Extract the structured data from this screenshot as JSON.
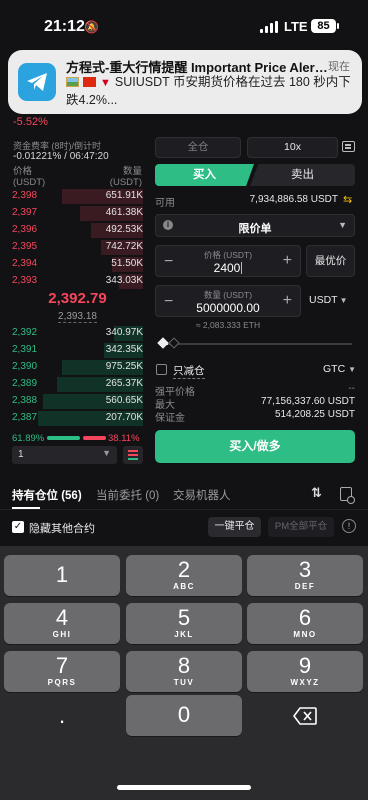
{
  "status_bar": {
    "time": "21:12",
    "network": "LTE",
    "battery": "85"
  },
  "notification": {
    "title": "方程式-重大行情提醒 Important Price Aler…",
    "time": "现在",
    "body": "SUIUSDT 币安期货价格在过去 180 秒内下跌4.2%..."
  },
  "ticker": {
    "change_pct": "-5.52%"
  },
  "funding": {
    "label": "资金费率 (8时)/倒计时",
    "value": "-0.01221% / 06:47:20"
  },
  "orderbook": {
    "col_price": "价格",
    "col_price_unit": "(USDT)",
    "col_qty": "数量",
    "col_qty_unit": "(USDT)",
    "asks": [
      {
        "price": "2,398",
        "qty": "651.91K",
        "depth": 0.62
      },
      {
        "price": "2,397",
        "qty": "461.38K",
        "depth": 0.48
      },
      {
        "price": "2,396",
        "qty": "492.53K",
        "depth": 0.4
      },
      {
        "price": "2,395",
        "qty": "742.72K",
        "depth": 0.32
      },
      {
        "price": "2,394",
        "qty": "51.50K",
        "depth": 0.24
      },
      {
        "price": "2,393",
        "qty": "343.03K",
        "depth": 0.18
      }
    ],
    "last_price": "2,392.79",
    "mark_price": "2,393.18",
    "bids": [
      {
        "price": "2,392",
        "qty": "340.97K",
        "depth": 0.22
      },
      {
        "price": "2,391",
        "qty": "342.35K",
        "depth": 0.3
      },
      {
        "price": "2,390",
        "qty": "975.25K",
        "depth": 0.62
      },
      {
        "price": "2,389",
        "qty": "265.37K",
        "depth": 0.66
      },
      {
        "price": "2,388",
        "qty": "560.65K",
        "depth": 0.76
      },
      {
        "price": "2,387",
        "qty": "207.70K",
        "depth": 0.8
      }
    ],
    "buy_ratio": "61.89%",
    "sell_ratio": "38.11%",
    "depth_value": "1"
  },
  "order_form": {
    "margin_mode": "全仓",
    "leverage": "10x",
    "buy_tab": "买入",
    "sell_tab": "卖出",
    "available_label": "可用",
    "available_value": "7,934,886.58 USDT",
    "order_type": "限价单",
    "price_caption": "价格 (USDT)",
    "price_value": "2400",
    "bbo_label": "最优价",
    "qty_caption": "数量 (USDT)",
    "qty_value": "5000000.00",
    "qty_unit": "USDT",
    "qty_equiv": "≈ 2,083.333 ETH",
    "reduce_only": "只减仓",
    "tif": "GTC",
    "liq_label": "强平价格",
    "liq_value": "--",
    "max_label": "最大",
    "max_value": "77,156,337.60 USDT",
    "margin_label": "保证金",
    "margin_value": "514,208.25 USDT",
    "submit_label": "买入/做多"
  },
  "positions": {
    "tabs": [
      "持有仓位 (56)",
      "当前委托 (0)",
      "交易机器人"
    ],
    "hide_other": "隐藏其他合约",
    "close_all": "一键平仓",
    "pm_close": "PM全部平仓"
  },
  "keyboard": {
    "keys": [
      {
        "digit": "1",
        "letters": ""
      },
      {
        "digit": "2",
        "letters": "ABC"
      },
      {
        "digit": "3",
        "letters": "DEF"
      },
      {
        "digit": "4",
        "letters": "GHI"
      },
      {
        "digit": "5",
        "letters": "JKL"
      },
      {
        "digit": "6",
        "letters": "MNO"
      },
      {
        "digit": "7",
        "letters": "PQRS"
      },
      {
        "digit": "8",
        "letters": "TUV"
      },
      {
        "digit": "9",
        "letters": "WXYZ"
      },
      {
        "digit": "0",
        "letters": ""
      }
    ],
    "dot": "."
  },
  "colors": {
    "buy": "#2ebd85",
    "sell": "#f6465d",
    "accent": "#f0b90b",
    "background": "#121214"
  }
}
